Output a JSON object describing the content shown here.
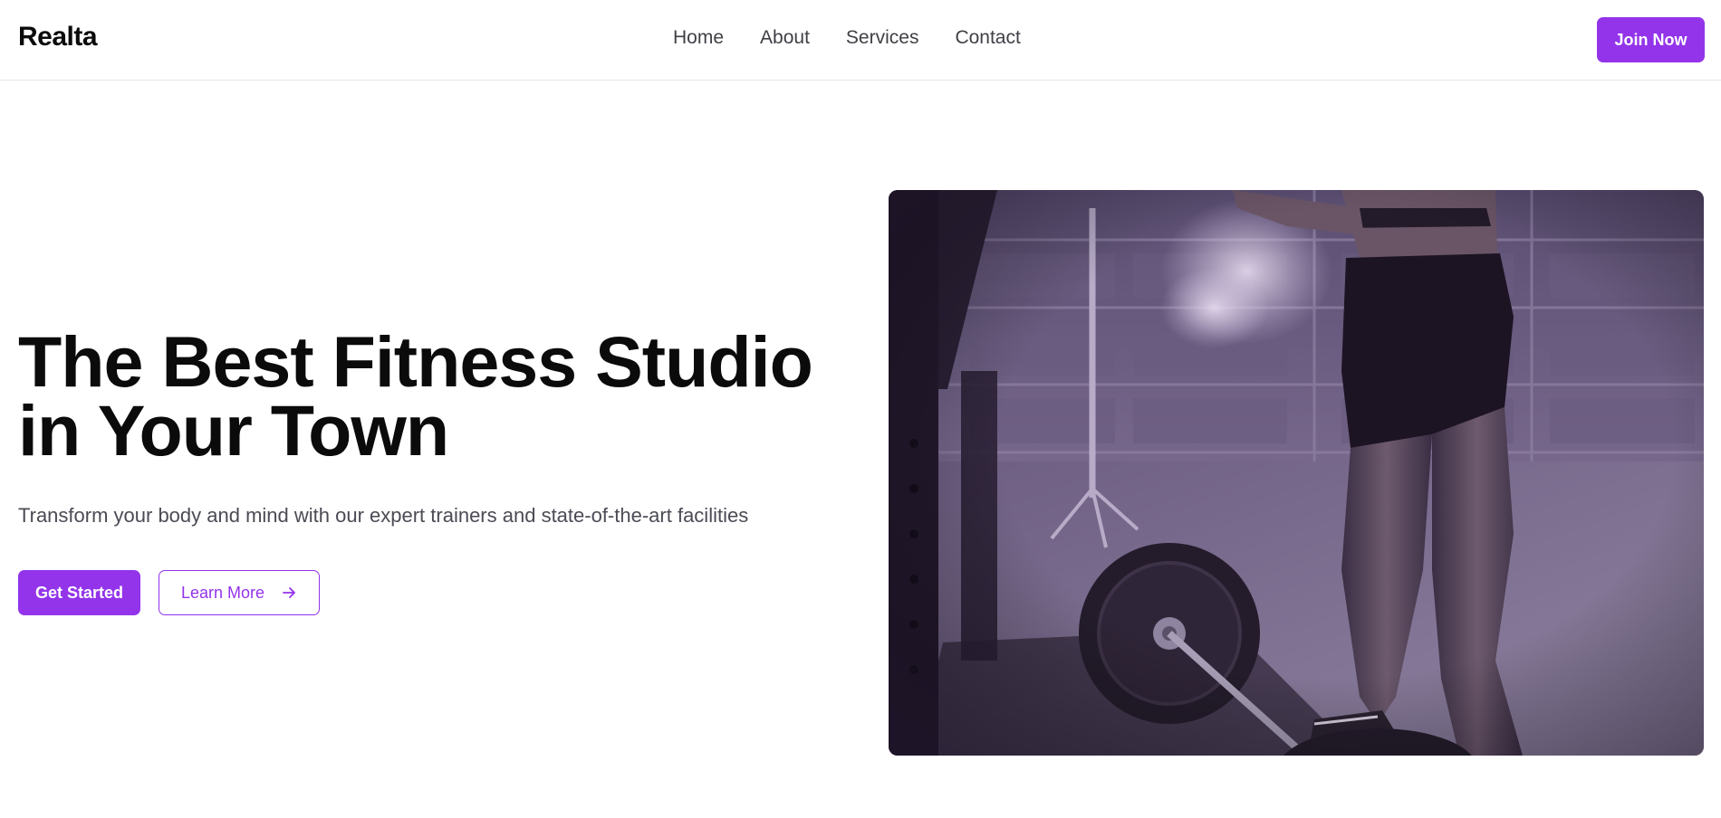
{
  "brand": {
    "name": "Realta"
  },
  "nav": {
    "items": [
      {
        "label": "Home"
      },
      {
        "label": "About"
      },
      {
        "label": "Services"
      },
      {
        "label": "Contact"
      }
    ],
    "cta_label": "Join Now"
  },
  "hero": {
    "title_line1": "The Best Fitness Studio",
    "title_line2": "in Your Town",
    "subtitle": "Transform your body and mind with our expert trainers and state-of-the-art facilities",
    "primary_label": "Get Started",
    "secondary_label": "Learn More",
    "secondary_icon": "arrow-right-icon",
    "image_name": "fitness-gym-photo"
  },
  "colors": {
    "accent": "#9333ea",
    "text_dark": "#0b0b0b",
    "text_muted": "#4b4b55",
    "border": "#e6e6e9"
  }
}
